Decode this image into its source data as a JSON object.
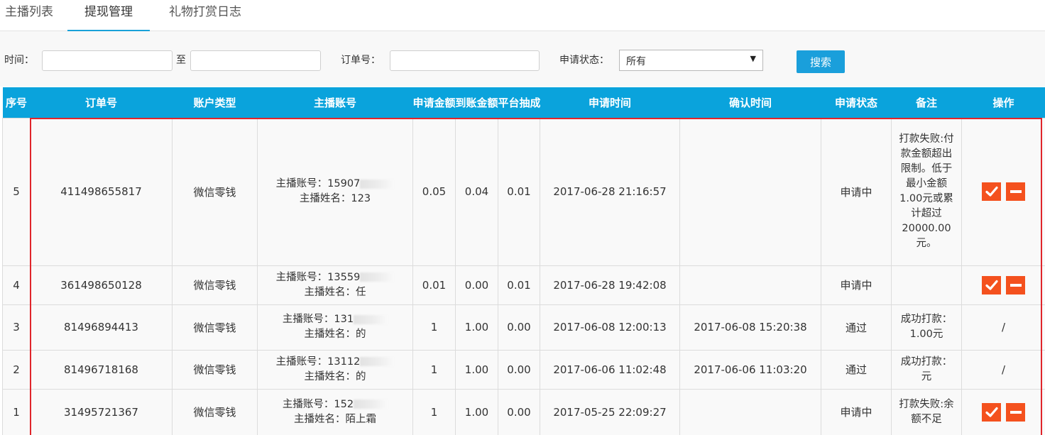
{
  "tabs": [
    {
      "label": "主播列表",
      "active": false
    },
    {
      "label": "提现管理",
      "active": true
    },
    {
      "label": "礼物打赏日志",
      "active": false
    }
  ],
  "filter": {
    "time_label": "时间：",
    "time_sep": "至",
    "time_start_value": "",
    "time_end_value": "",
    "order_label": "订单号：",
    "order_value": "",
    "status_label": "申请状态：",
    "status_selected": "所有",
    "search_button": "搜索"
  },
  "table": {
    "headers": [
      "序号",
      "订单号",
      "账户类型",
      "主播账号",
      "申请金额",
      "到账金额",
      "平台抽成",
      "申请时间",
      "确认时间",
      "申请状态",
      "备注",
      "操作"
    ],
    "rows": [
      {
        "seq": "5",
        "order": "411498655817",
        "type": "微信零钱",
        "account_label": "主播账号：15907",
        "name_label": "主播姓名：123",
        "apply": "0.05",
        "received": "0.04",
        "fee": "0.01",
        "apply_time": "2017-06-28 21:16:57",
        "confirm_time": "",
        "status": "申请中",
        "note": "打款失败:付款金额超出限制。低于最小金额1.00元或累计超过20000.00元。",
        "has_actions": true,
        "op_text": ""
      },
      {
        "seq": "4",
        "order": "361498650128",
        "type": "微信零钱",
        "account_label": "主播账号：13559",
        "name_label": "主播姓名：任",
        "apply": "0.01",
        "received": "0.00",
        "fee": "0.01",
        "apply_time": "2017-06-28 19:42:08",
        "confirm_time": "",
        "status": "申请中",
        "note": "",
        "has_actions": true,
        "op_text": ""
      },
      {
        "seq": "3",
        "order": "81496894413",
        "type": "微信零钱",
        "account_label": "主播账号：131",
        "name_label": "主播姓名：的",
        "apply": "1",
        "received": "1.00",
        "fee": "0.00",
        "apply_time": "2017-06-08 12:00:13",
        "confirm_time": "2017-06-08 15:20:38",
        "status": "通过",
        "note": "成功打款：1.00元",
        "has_actions": false,
        "op_text": "/"
      },
      {
        "seq": "2",
        "order": "81496718168",
        "type": "微信零钱",
        "account_label": "主播账号：13112",
        "name_label": "主播姓名：的",
        "apply": "1",
        "received": "1.00",
        "fee": "0.00",
        "apply_time": "2017-06-06 11:02:48",
        "confirm_time": "2017-06-06 11:03:20",
        "status": "通过",
        "note": "成功打款：元",
        "has_actions": false,
        "op_text": "/"
      },
      {
        "seq": "1",
        "order": "31495721367",
        "type": "微信零钱",
        "account_label": "主播账号：152",
        "name_label": "主播姓名：陌上霜",
        "apply": "1",
        "received": "1.00",
        "fee": "0.00",
        "apply_time": "2017-05-25 22:09:27",
        "confirm_time": "",
        "status": "申请中",
        "note": "打款失败:余额不足",
        "has_actions": true,
        "op_text": ""
      }
    ]
  },
  "colors": {
    "header_bg": "#0aa3dc",
    "accent": "#19a1d8",
    "action_button": "#f4511e",
    "highlight_border": "#e0252b"
  },
  "icons": {
    "approve": "check-icon",
    "reject": "minus-icon",
    "select": "chevron-down-icon"
  }
}
